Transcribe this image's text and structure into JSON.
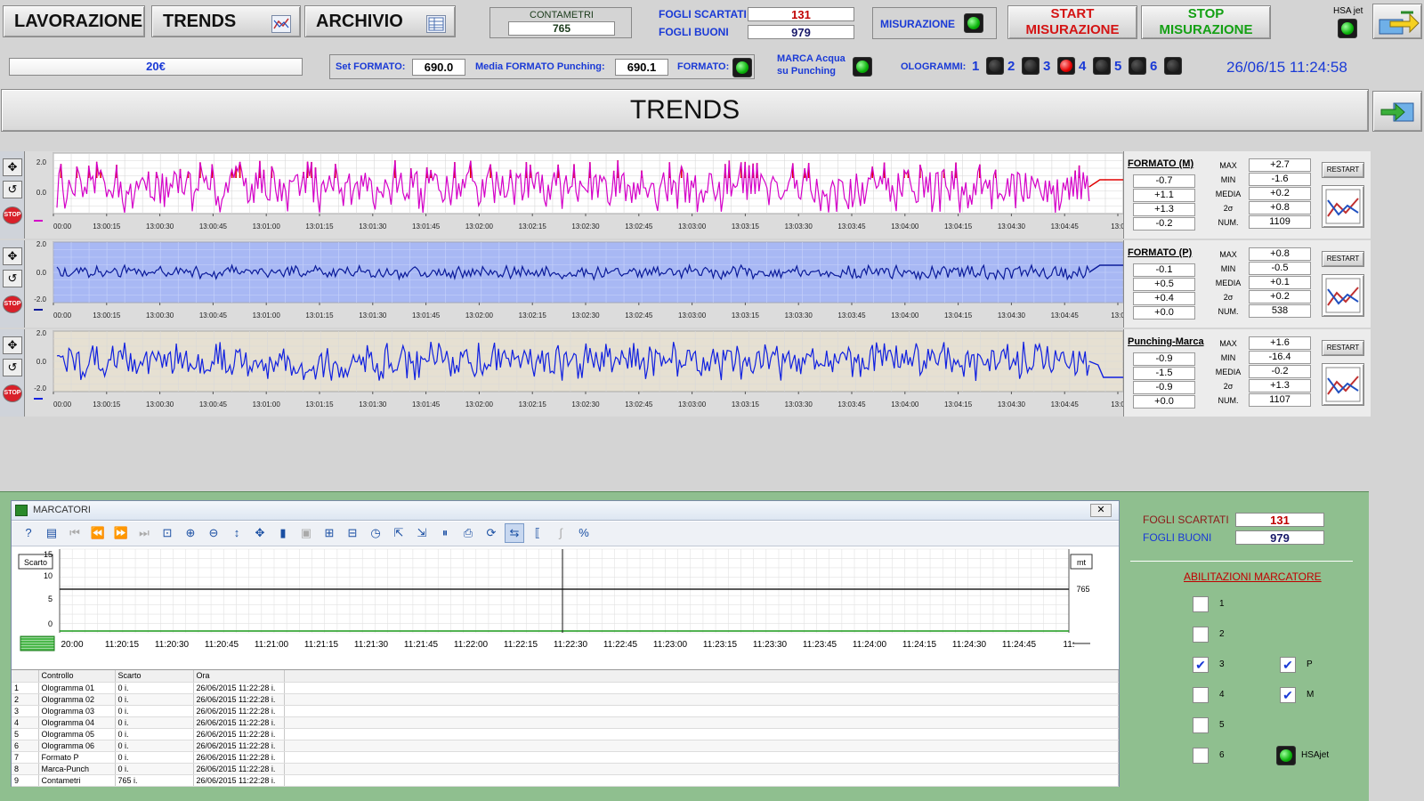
{
  "nav": {
    "lavorazione": "LAVORAZIONE",
    "trends": "TRENDS",
    "archivio": "ARCHIVIO"
  },
  "counters": {
    "contametri_label": "CONTAMETRI",
    "contametri_value": "765",
    "fogli_scartati_label": "FOGLI SCARTATI",
    "fogli_scartati_value": "131",
    "fogli_buoni_label": "FOGLI BUONI",
    "fogli_buoni_value": "979",
    "misurazione_label": "MISURAZIONE"
  },
  "actions": {
    "start_line1": "START",
    "start_line2": "MISURAZIONE",
    "stop_line1": "STOP",
    "stop_line2": "MISURAZIONE",
    "hsa_label": "HSA jet"
  },
  "status_bar": {
    "product": "20€",
    "set_formato_label": "Set FORMATO:",
    "set_formato_value": "690.0",
    "media_label": "Media FORMATO Punching:",
    "media_value": "690.1",
    "formato_label": "FORMATO:",
    "marca_line1": "MARCA Acqua",
    "marca_line2": "su  Punching",
    "ologrammi_label": "OLOGRAMMI:",
    "ologrammi": [
      {
        "n": "1",
        "state": "off"
      },
      {
        "n": "2",
        "state": "off"
      },
      {
        "n": "3",
        "state": "red"
      },
      {
        "n": "4",
        "state": "off"
      },
      {
        "n": "5",
        "state": "off"
      },
      {
        "n": "6",
        "state": "off"
      }
    ],
    "datetime": "26/06/15 11:24:58"
  },
  "page_title": "TRENDS",
  "trend_axis": {
    "x_ticks": [
      "00:00",
      "13:00:15",
      "13:00:30",
      "13:00:45",
      "13:01:00",
      "13:01:15",
      "13:01:30",
      "13:01:45",
      "13:02:00",
      "13:02:15",
      "13:02:30",
      "13:02:45",
      "13:03:00",
      "13:03:15",
      "13:03:30",
      "13:03:45",
      "13:04:00",
      "13:04:15",
      "13:04:30",
      "13:04:45",
      "13:0"
    ],
    "y_ticks_a": [
      "2.0",
      "0.0"
    ],
    "y_ticks_b": [
      "2.0",
      "0.0",
      "-2.0"
    ]
  },
  "trend_panels": [
    {
      "title": "FORMATO (M)",
      "devs": [
        "-0.7",
        "+1.1",
        "+1.3",
        "-0.2"
      ],
      "stats": [
        {
          "label": "MAX",
          "value": "+2.7"
        },
        {
          "label": "MIN",
          "value": "-1.6"
        },
        {
          "label": "MEDIA",
          "value": "+0.2"
        },
        {
          "label": "2σ",
          "value": "+0.8"
        },
        {
          "label": "NUM.",
          "value": "1109"
        }
      ],
      "restart": "RESTART",
      "color": "#d400c8",
      "alert_color": "#e00000",
      "bg": "#ffffff"
    },
    {
      "title": "FORMATO (P)",
      "devs": [
        "-0.1",
        "+0.5",
        "+0.4",
        "+0.0"
      ],
      "stats": [
        {
          "label": "MAX",
          "value": "+0.8"
        },
        {
          "label": "MIN",
          "value": "-0.5"
        },
        {
          "label": "MEDIA",
          "value": "+0.1"
        },
        {
          "label": "2σ",
          "value": "+0.2"
        },
        {
          "label": "NUM.",
          "value": "538"
        }
      ],
      "restart": "RESTART",
      "color": "#0a1a9a",
      "bg": "#a8b8f4"
    },
    {
      "title": "Punching-Marca",
      "devs": [
        "-0.9",
        "-1.5",
        "-0.9",
        "+0.0"
      ],
      "stats": [
        {
          "label": "MAX",
          "value": "+1.6"
        },
        {
          "label": "MIN",
          "value": "-16.4"
        },
        {
          "label": "MEDIA",
          "value": "-0.2"
        },
        {
          "label": "2σ",
          "value": "+1.3"
        },
        {
          "label": "NUM.",
          "value": "1107"
        }
      ],
      "restart": "RESTART",
      "color": "#1020e0",
      "bg": "#e6e0d2"
    }
  ],
  "marcatori": {
    "title": "MARCATORI",
    "y_label": "Scarto",
    "right_label": "mt",
    "right_value": "765",
    "y_ticks": [
      "15",
      "10",
      "5",
      "0"
    ],
    "x_ticks": [
      "20:00",
      "11:20:15",
      "11:20:30",
      "11:20:45",
      "11:21:00",
      "11:21:15",
      "11:21:30",
      "11:21:45",
      "11:22:00",
      "11:22:15",
      "11:22:30",
      "11:22:45",
      "11:23:00",
      "11:23:15",
      "11:23:30",
      "11:23:45",
      "11:24:00",
      "11:24:15",
      "11:24:30",
      "11:24:45",
      "11:"
    ],
    "table_headers": [
      "",
      "Controllo",
      "Scarto",
      "Ora"
    ],
    "rows": [
      [
        "1",
        "Ologramma 01",
        "0 i.",
        "26/06/2015 11:22:28 i."
      ],
      [
        "2",
        "Ologramma 02",
        "0 i.",
        "26/06/2015 11:22:28 i."
      ],
      [
        "3",
        "Ologramma 03",
        "0 i.",
        "26/06/2015 11:22:28 i."
      ],
      [
        "4",
        "Ologramma 04",
        "0 i.",
        "26/06/2015 11:22:28 i."
      ],
      [
        "5",
        "Ologramma 05",
        "0 i.",
        "26/06/2015 11:22:28 i."
      ],
      [
        "6",
        "Ologramma 06",
        "0 i.",
        "26/06/2015 11:22:28 i."
      ],
      [
        "7",
        "Formato P",
        "0 i.",
        "26/06/2015 11:22:28 i."
      ],
      [
        "8",
        "Marca-Punch",
        "0 i.",
        "26/06/2015 11:22:28 i."
      ],
      [
        "9",
        "Contametri",
        "765 i.",
        "26/06/2015 11:22:28 i."
      ]
    ]
  },
  "side_panel": {
    "fogli_scartati_label": "FOGLI SCARTATI",
    "fogli_scartati_value": "131",
    "fogli_buoni_label": "FOGLI BUONI",
    "fogli_buoni_value": "979",
    "abilitazioni_title": "ABILITAZIONI  MARCATORE",
    "checks": [
      {
        "label": "1",
        "checked": false
      },
      {
        "label": "2",
        "checked": false
      },
      {
        "label": "3",
        "checked": true
      },
      {
        "label": "4",
        "checked": false
      },
      {
        "label": "5",
        "checked": false
      },
      {
        "label": "6",
        "checked": false
      }
    ],
    "checks_right": [
      {
        "label": "P",
        "checked": true
      },
      {
        "label": "M",
        "checked": true
      }
    ],
    "hsajet_label": "HSAjet"
  }
}
